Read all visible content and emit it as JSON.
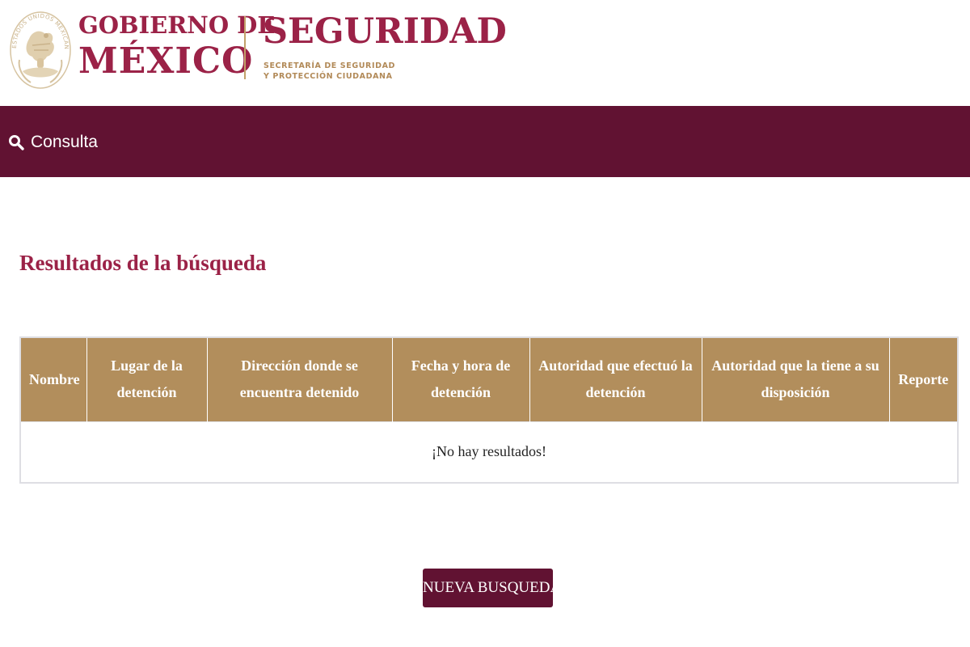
{
  "header": {
    "seal_text": "ESTADOS UNIDOS MEXICANOS",
    "gov_line1": "GOBIERNO DE",
    "gov_line2": "MÉXICO",
    "dependency": "SEGURIDAD",
    "dependency_sub1": "SECRETARÍA DE SEGURIDAD",
    "dependency_sub2": "Y PROTECCIÓN CIUDADANA",
    "colors": {
      "guinda": "#9b2247",
      "gold": "#b28a58"
    }
  },
  "nav": {
    "icon": "search-icon",
    "label": "Consulta",
    "background": "#611232"
  },
  "main": {
    "title": "Resultados de la búsqueda",
    "table": {
      "header_color": "#b28e5c",
      "columns": [
        "Nombre",
        "Lugar de la detención",
        "Dirección donde se encuentra detenido",
        "Fecha y hora de detención",
        "Autoridad que efectuó la detención",
        "Autoridad que la tiene a su disposición",
        "Reporte"
      ],
      "empty_message": "¡No hay resultados!"
    },
    "new_search_label": "NUEVA BUSQUEDA"
  }
}
